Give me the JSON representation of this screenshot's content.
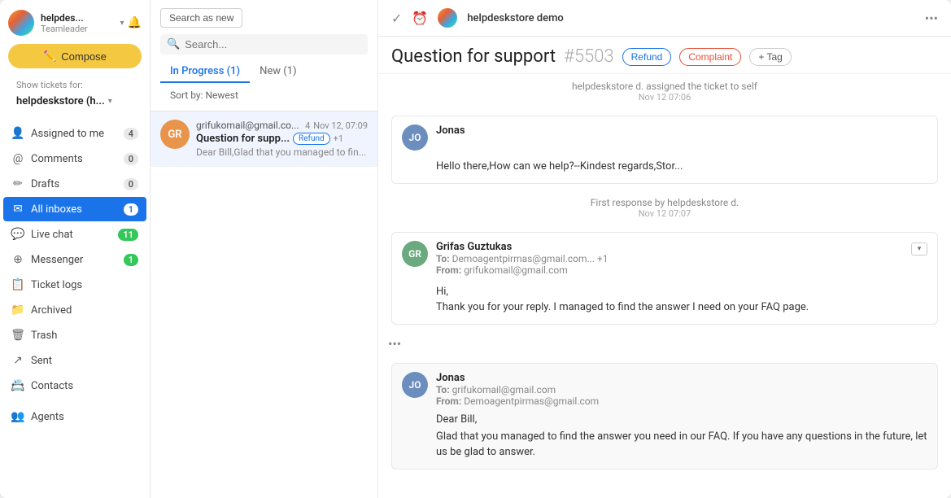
{
  "sidebar": {
    "brand": {
      "name": "helpdes...",
      "role": "Teamleader"
    },
    "compose_label": "Compose",
    "show_tickets_label": "Show tickets for:",
    "team_name": "helpdeskstore (h...",
    "nav_items": [
      {
        "id": "assigned",
        "label": "Assigned to me",
        "badge": "4",
        "badge_type": "normal",
        "icon": "person"
      },
      {
        "id": "comments",
        "label": "Comments",
        "badge": "0",
        "badge_type": "normal",
        "icon": "comment"
      },
      {
        "id": "drafts",
        "label": "Drafts",
        "badge": "0",
        "badge_type": "normal",
        "icon": "pencil"
      },
      {
        "id": "all-inboxes",
        "label": "All inboxes",
        "badge": "1",
        "badge_type": "blue",
        "icon": "inbox",
        "active": true
      },
      {
        "id": "live-chat",
        "label": "Live chat",
        "badge": "11",
        "badge_type": "green",
        "icon": "chat"
      },
      {
        "id": "messenger",
        "label": "Messenger",
        "badge": "1",
        "badge_type": "green",
        "icon": "messenger"
      },
      {
        "id": "ticket-logs",
        "label": "Ticket logs",
        "badge": "",
        "icon": "log"
      },
      {
        "id": "archived",
        "label": "Archived",
        "badge": "",
        "icon": "archive"
      },
      {
        "id": "trash",
        "label": "Trash",
        "badge": "",
        "icon": "trash"
      },
      {
        "id": "sent",
        "label": "Sent",
        "badge": "",
        "icon": "sent"
      },
      {
        "id": "contacts",
        "label": "Contacts",
        "badge": "",
        "icon": "contacts"
      }
    ],
    "agents_label": "Agents"
  },
  "conv_list": {
    "search_as_new": "Search as new",
    "search_placeholder": "Search...",
    "tabs": [
      {
        "id": "in-progress",
        "label": "In Progress (1)",
        "active": true
      },
      {
        "id": "new",
        "label": "New (1)",
        "active": false
      }
    ],
    "sort_label": "Sort by: Newest",
    "conversations": [
      {
        "from": "grifukomail@gmail.co...",
        "count": "4",
        "date": "Nov 12, 07:09",
        "subject": "Question for supp...",
        "tag": "Refund",
        "plus": "+1",
        "preview": "Dear Bill,Glad that you managed to fin...",
        "avatar_initials": "GR",
        "avatar_color": "orange"
      }
    ]
  },
  "main": {
    "header": {
      "agent_name": "helpdeskstore demo",
      "dots": "•••"
    },
    "ticket": {
      "title": "Question for support",
      "number": "#5503",
      "tags": [
        "Refund",
        "Complaint",
        "+ Tag"
      ]
    },
    "system_msg1": {
      "text": "helpdeskstore d. assigned the ticket to self",
      "time": "Nov 12 07:06"
    },
    "messages": [
      {
        "id": "jonas-first",
        "sender": "Jonas",
        "avatar_initials": "JO",
        "avatar_color": "blue-gray",
        "body": "Hello there,How can we help?--Kindest regards,Stor..."
      },
      {
        "id": "first-response-divider",
        "text": "First response by helpdeskstore d.",
        "time": "Nov 12 07:07"
      },
      {
        "id": "grifas",
        "sender": "Grifas Guztukas",
        "avatar_initials": "GR",
        "avatar_color": "green-gray",
        "to": "Demoagentpirmas@gmail.com... +1",
        "from": "grifukomail@gmail.com",
        "body_greeting": "Hi,",
        "body_text": "Thank you for your reply. I managed to find the answer I need on your FAQ page."
      }
    ],
    "dots_row": "•••",
    "jonas_reply": {
      "sender": "Jonas",
      "avatar_initials": "JO",
      "avatar_color": "blue-gray",
      "to": "grifukomail@gmail.com",
      "from": "Demoagentpirmas@gmail.com",
      "greeting": "Dear Bill,",
      "body": "Glad that you managed to find the answer you need in our FAQ. If you have any questions in the future, let us be glad to answer."
    }
  }
}
